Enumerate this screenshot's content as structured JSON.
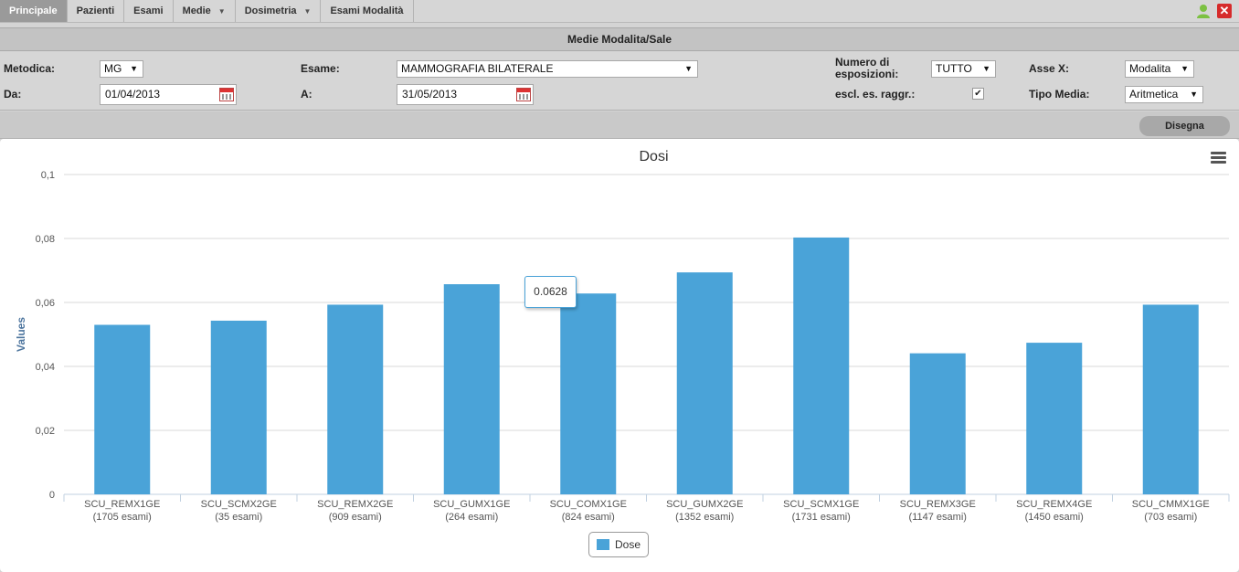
{
  "nav": {
    "items": [
      {
        "label": "Principale",
        "active": true,
        "caret": false
      },
      {
        "label": "Pazienti",
        "active": false,
        "caret": false
      },
      {
        "label": "Esami",
        "active": false,
        "caret": false
      },
      {
        "label": "Medie",
        "active": false,
        "caret": true
      },
      {
        "label": "Dosimetria",
        "active": false,
        "caret": true
      },
      {
        "label": "Esami Modalità",
        "active": false,
        "caret": false
      }
    ],
    "close_glyph": "✕"
  },
  "panel": {
    "title": "Medie Modalita/Sale"
  },
  "filters": {
    "metodica_label": "Metodica:",
    "metodica_value": "MG",
    "esame_label": "Esame:",
    "esame_value": "MAMMOGRAFIA BILATERALE",
    "numero_label_line1": "Numero di",
    "numero_label_line2": "esposizioni:",
    "numero_value": "TUTTO",
    "asse_label": "Asse X:",
    "asse_value": "Modalita",
    "da_label": "Da:",
    "da_value": "01/04/2013",
    "a_label": "A:",
    "a_value": "31/05/2013",
    "escl_label": "escl. es. raggr.:",
    "escl_checked": true,
    "tipo_label": "Tipo Media:",
    "tipo_value": "Aritmetica",
    "arrow_glyph": "▼",
    "check_glyph": "✔"
  },
  "toolbar": {
    "draw_label": "Disegna"
  },
  "tooltip": {
    "value": "0.0628"
  },
  "chart_data": {
    "type": "bar",
    "title": "Dosi",
    "xlabel": "",
    "ylabel": "Values",
    "ylim": [
      0,
      0.1
    ],
    "yticks": [
      "0",
      "0,02",
      "0,04",
      "0,06",
      "0,08",
      "0,1"
    ],
    "grid": true,
    "legend_position": "bottom-center",
    "color": "#4aa3d8",
    "categories": [
      {
        "name": "SCU_REMX1GE",
        "count": "(1705 esami)"
      },
      {
        "name": "SCU_SCMX2GE",
        "count": "(35 esami)"
      },
      {
        "name": "SCU_REMX2GE",
        "count": "(909 esami)"
      },
      {
        "name": "SCU_GUMX1GE",
        "count": "(264 esami)"
      },
      {
        "name": "SCU_COMX1GE",
        "count": "(824 esami)"
      },
      {
        "name": "SCU_GUMX2GE",
        "count": "(1352 esami)"
      },
      {
        "name": "SCU_SCMX1GE",
        "count": "(1731 esami)"
      },
      {
        "name": "SCU_REMX3GE",
        "count": "(1147 esami)"
      },
      {
        "name": "SCU_REMX4GE",
        "count": "(1450 esami)"
      },
      {
        "name": "SCU_CMMX1GE",
        "count": "(703 esami)"
      }
    ],
    "series": [
      {
        "name": "Dose",
        "values": [
          0.053,
          0.0543,
          0.0593,
          0.0657,
          0.0628,
          0.0694,
          0.0803,
          0.0441,
          0.0474,
          0.0593
        ]
      }
    ]
  }
}
